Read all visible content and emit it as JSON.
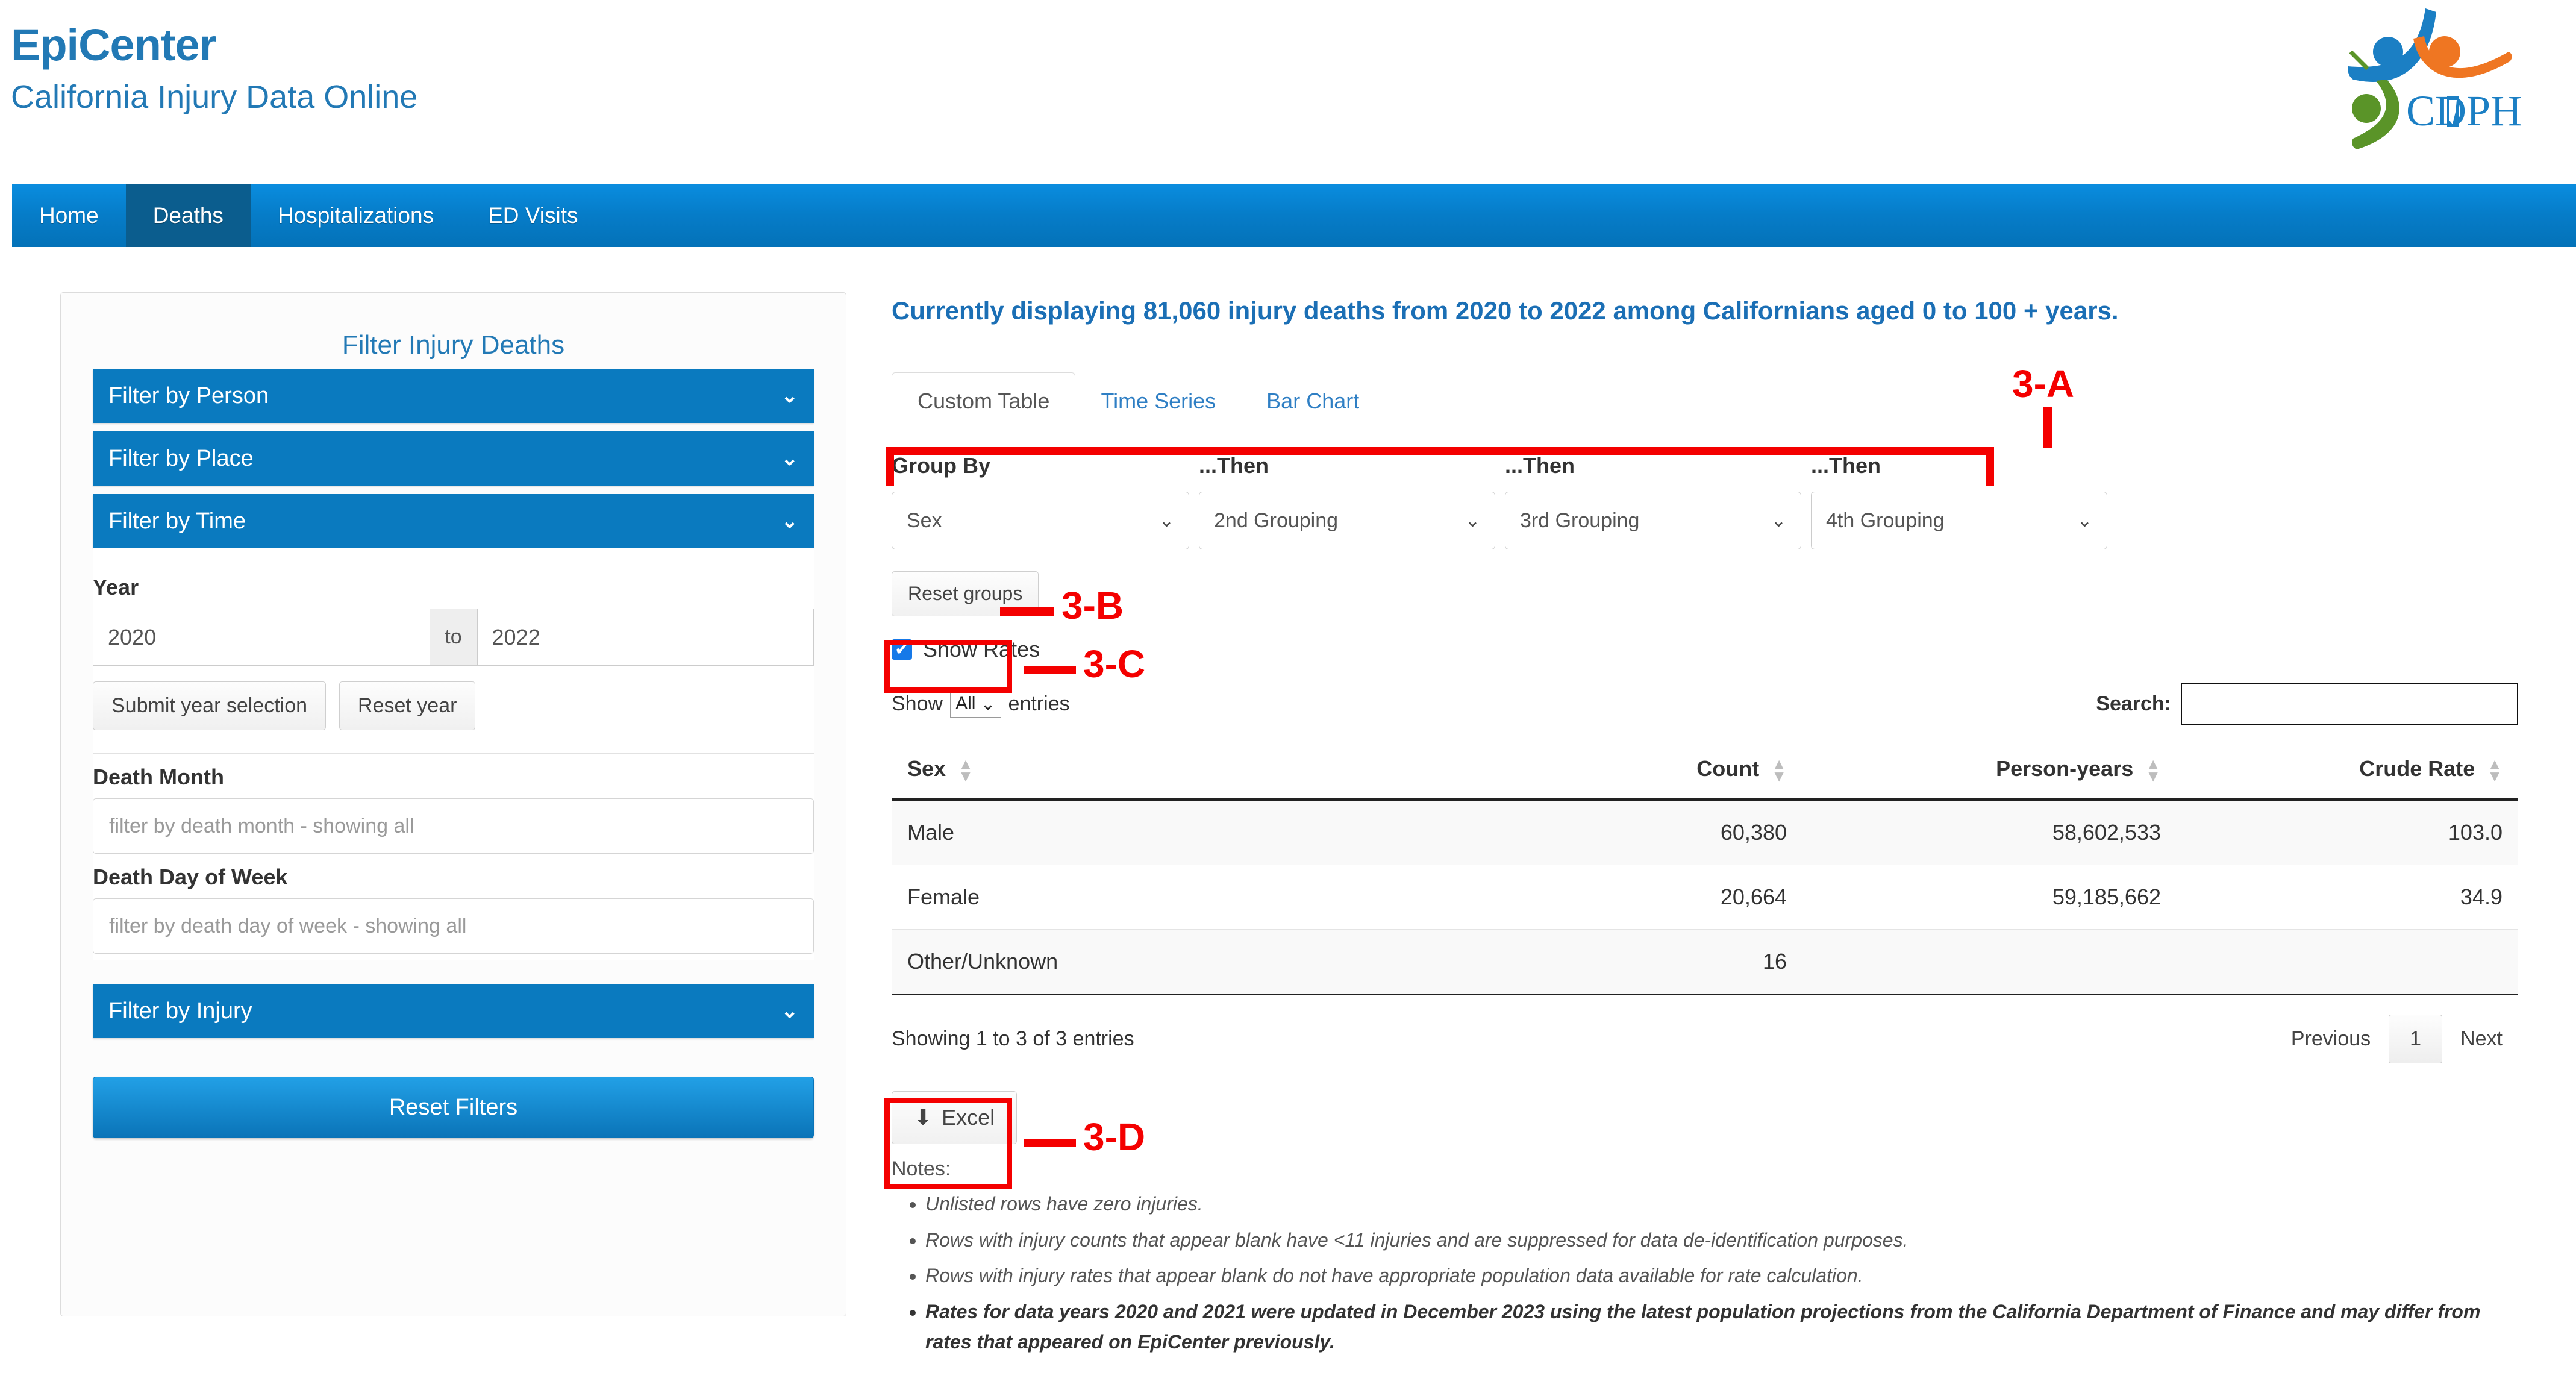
{
  "header": {
    "brand_title": "EpiCenter",
    "brand_subtitle": "California Injury Data Online",
    "logo_text": "CDPH",
    "logo_name": "cdph-logo"
  },
  "nav": {
    "items": [
      {
        "label": "Home",
        "active": false
      },
      {
        "label": "Deaths",
        "active": true
      },
      {
        "label": "Hospitalizations",
        "active": false
      },
      {
        "label": "ED Visits",
        "active": false
      }
    ]
  },
  "sidebar": {
    "title": "Filter Injury Deaths",
    "accordions": [
      {
        "label": "Filter by Person",
        "chevron": "⌄",
        "expanded": false
      },
      {
        "label": "Filter by Place",
        "chevron": "⌄",
        "expanded": false
      },
      {
        "label": "Filter by Time",
        "chevron": "⌄",
        "expanded": true
      },
      {
        "label": "Filter by Injury",
        "chevron": "⌄",
        "expanded": false
      }
    ],
    "time_panel": {
      "year_label": "Year",
      "year_from": "2020",
      "year_to_separator": "to",
      "year_to": "2022",
      "submit_label": "Submit year selection",
      "reset_year_label": "Reset year",
      "death_month_label": "Death Month",
      "death_month_placeholder": "filter by death month - showing all",
      "death_day_label": "Death Day of Week",
      "death_day_placeholder": "filter by death day of week - showing all"
    },
    "reset_filters_label": "Reset Filters"
  },
  "main": {
    "results_heading": "Currently displaying 81,060 injury deaths from 2020 to 2022 among Californians aged 0 to 100 + years.",
    "tabs": [
      {
        "label": "Custom Table",
        "active": true
      },
      {
        "label": "Time Series",
        "active": false
      },
      {
        "label": "Bar Chart",
        "active": false
      }
    ],
    "group_by": {
      "headers": [
        "Group By",
        "...Then",
        "...Then",
        "...Then"
      ],
      "selects": [
        "Sex",
        "2nd Grouping",
        "3rd Grouping",
        "4th Grouping"
      ],
      "caret": "⌄",
      "reset_groups_label": "Reset groups",
      "show_rates_label": "Show Rates",
      "show_rates_checked": true,
      "checkmark": "✔"
    },
    "table_controls": {
      "show_label": "Show",
      "entries_value": "All",
      "entries_caret": "⌄",
      "entries_label": "entries",
      "search_label": "Search:",
      "search_value": "",
      "search_placeholder": ""
    },
    "table": {
      "columns": [
        "Sex",
        "Count",
        "Person-years",
        "Crude Rate"
      ],
      "rows": [
        {
          "sex": "Male",
          "count": "60,380",
          "person_years": "58,602,533",
          "crude_rate": "103.0"
        },
        {
          "sex": "Female",
          "count": "20,664",
          "person_years": "59,185,662",
          "crude_rate": "34.9"
        },
        {
          "sex": "Other/Unknown",
          "count": "16",
          "person_years": "",
          "crude_rate": ""
        }
      ]
    },
    "table_footer": {
      "entries_info": "Showing 1 to 3 of 3 entries",
      "previous_label": "Previous",
      "page_number": "1",
      "next_label": "Next"
    },
    "excel_button": {
      "label": "Excel",
      "icon": "⬇"
    },
    "notes": {
      "title": "Notes:",
      "items": [
        {
          "text": "Unlisted rows have zero injuries.",
          "bold": false
        },
        {
          "text": "Rows with injury counts that appear blank have <11 injuries and are suppressed for data de-identification purposes.",
          "bold": false
        },
        {
          "text": "Rows with injury rates that appear blank do not have appropriate population data available for rate calculation.",
          "bold": false
        },
        {
          "text": "Rates for data years 2020 and 2021 were updated in December 2023 using the latest population projections from the California Department of Finance and may differ from rates that appeared on EpiCenter previously.",
          "bold": true
        }
      ]
    }
  },
  "annotations": {
    "color": "#f40000",
    "labels": [
      {
        "id": "3-A",
        "text": "3-A"
      },
      {
        "id": "3-B",
        "text": "3-B"
      },
      {
        "id": "3-C",
        "text": "3-C"
      },
      {
        "id": "3-D",
        "text": "3-D"
      }
    ]
  },
  "colors": {
    "brand_blue": "#2279b5",
    "nav_blue": "#067cc8",
    "nav_active_blue": "#0b5d8e",
    "accordion_blue": "#0a7abf",
    "annotation_red": "#f40000",
    "checkbox_blue": "#1679e8"
  }
}
